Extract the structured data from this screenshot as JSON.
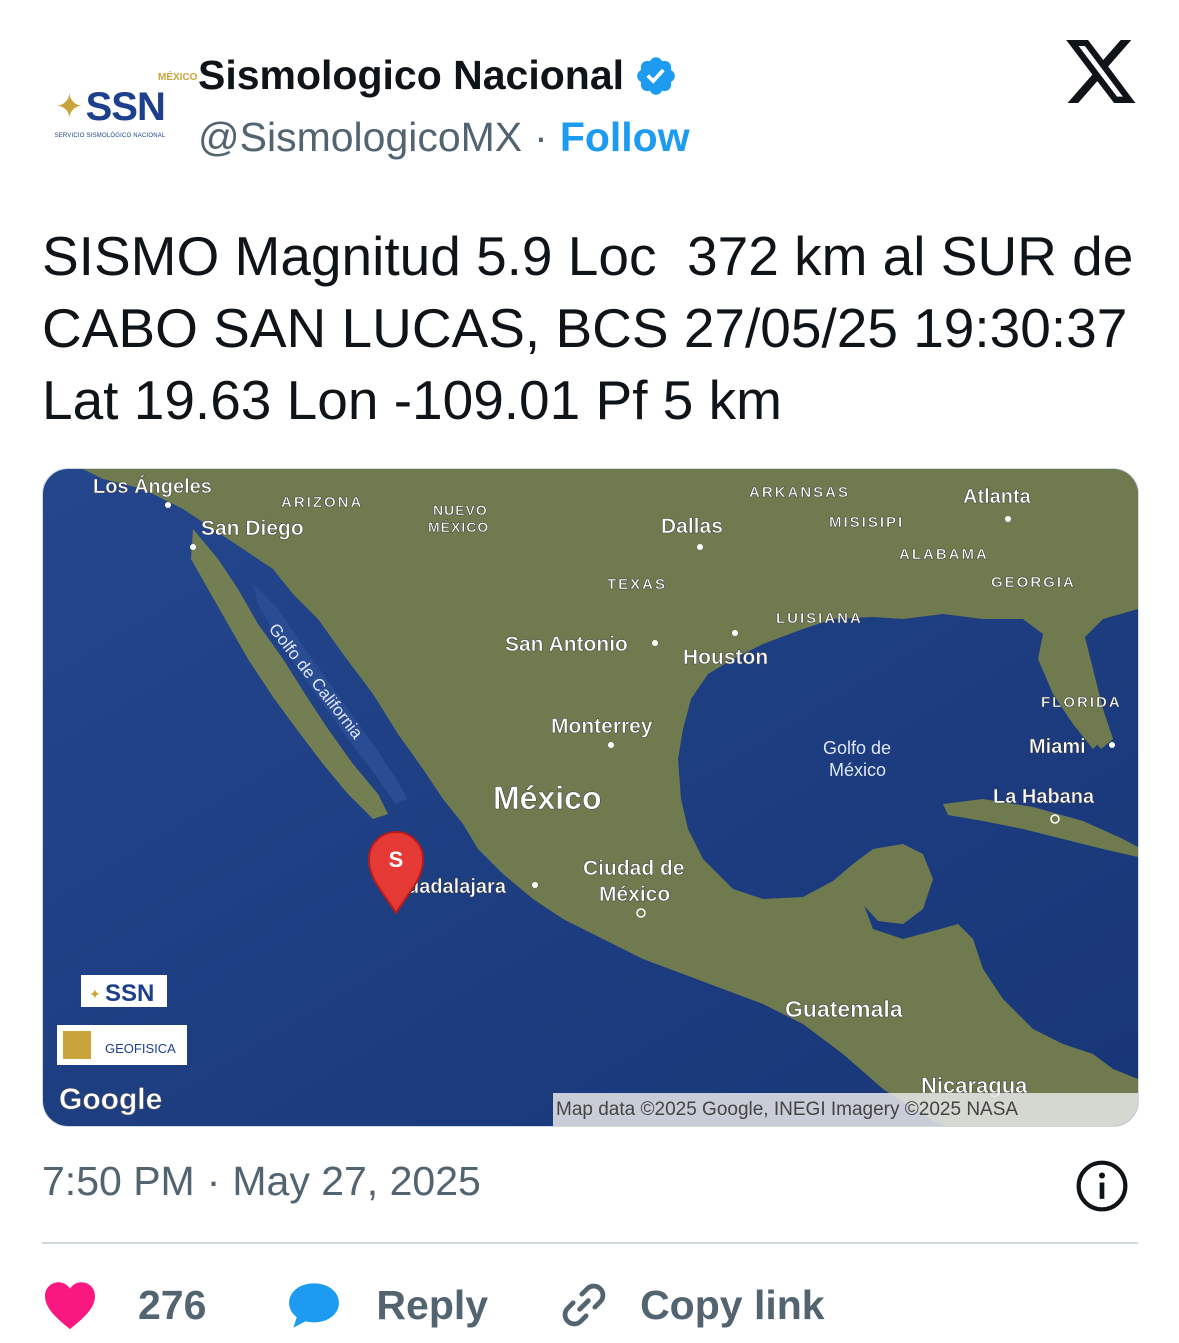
{
  "author": {
    "display_name": "Sismologico Nacional",
    "handle": "@SismologicoMX",
    "separator": "·",
    "follow_label": "Follow",
    "avatar": {
      "logo_text": "SSN",
      "country_text": "MÉXICO",
      "subtitle": "SERVICIO SISMOLÓGICO NACIONAL"
    }
  },
  "tweet": {
    "text": "SISMO Magnitud 5.9 Loc  372 km al SUR de CABO SAN LUCAS, BCS 27/05/25 19:30:37 Lat 19.63 Lon -109.01 Pf 5 km",
    "time": "7:50 PM",
    "separator": "·",
    "date": "May 27, 2025"
  },
  "map": {
    "labels": {
      "los_angeles": "Los Ángeles",
      "san_diego": "San Diego",
      "arizona": "ARIZONA",
      "nuevo_1": "NUEVO",
      "nuevo_2": "MÉXICO",
      "arkansas": "ARKANSAS",
      "atlanta": "Atlanta",
      "dallas": "Dallas",
      "misisipi": "MISISIPI",
      "alabama": "ALABAMA",
      "texas": "TEXAS",
      "georgia": "GEORGIA",
      "luisiana": "LUISIANA",
      "san_antonio": "San Antonio",
      "houston": "Houston",
      "golfo_california": "Golfo de California",
      "florida": "FLORIDA",
      "monterrey": "Monterrey",
      "golfo_mexico_1": "Golfo de",
      "golfo_mexico_2": "México",
      "miami": "Miami",
      "mexico": "México",
      "la_habana": "La Habana",
      "guadalajara": "uadalajara",
      "cdmx_1": "Ciudad de",
      "cdmx_2": "México",
      "guatemala": "Guatemala",
      "nicaragua": "Nicaragua",
      "google": "Google",
      "attribution": "Map data ©2025 Google, INEGI Imagery ©2025 NASA",
      "marker": "S",
      "ssn_badge": "SSN",
      "geofisica_badge": "GEOFISICA"
    },
    "colors": {
      "ocean": "#1f3f86",
      "land": "#6d7a4e",
      "marker": "#e53935"
    }
  },
  "engagement": {
    "likes": "276",
    "reply_label": "Reply",
    "copy_label": "Copy link"
  },
  "colors": {
    "accent": "#1d9bf0",
    "like": "#f91880",
    "secondary_text": "#536471"
  }
}
